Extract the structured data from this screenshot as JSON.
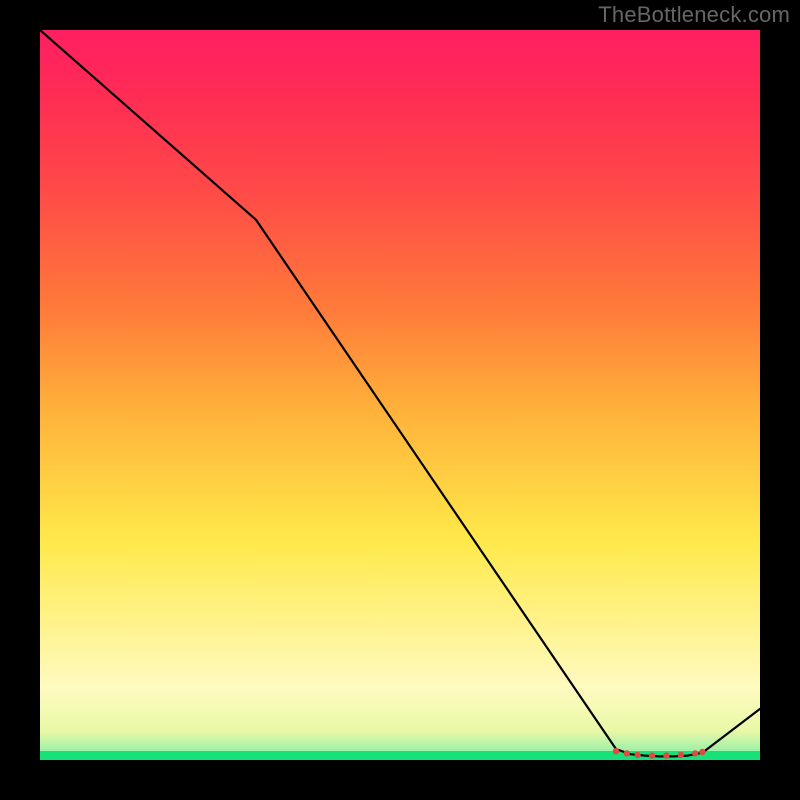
{
  "watermark": "TheBottleneck.com",
  "chart_data": {
    "type": "line",
    "title": "",
    "xlabel": "",
    "ylabel": "",
    "xlim": [
      0,
      100
    ],
    "ylim": [
      0,
      100
    ],
    "series": [
      {
        "name": "bottleneck-curve",
        "x": [
          0,
          30,
          80,
          82,
          84,
          86,
          88,
          90,
          92,
          100
        ],
        "y": [
          100,
          74,
          1.5,
          0.8,
          0.6,
          0.5,
          0.5,
          0.6,
          1.0,
          7
        ]
      }
    ],
    "markers": {
      "name": "flat-region-dots",
      "x": [
        80,
        81.5,
        83,
        85,
        87,
        89,
        91,
        92
      ],
      "y": [
        1.2,
        0.9,
        0.7,
        0.6,
        0.6,
        0.7,
        0.9,
        1.1
      ],
      "color": "#e4483f"
    },
    "gradient_stops": [
      {
        "pos": 0.0,
        "color": "#17e27a"
      },
      {
        "pos": 0.012,
        "color": "#17e27a"
      },
      {
        "pos": 0.04,
        "color": "#e9f9a6"
      },
      {
        "pos": 0.1,
        "color": "#fffac0"
      },
      {
        "pos": 0.3,
        "color": "#ffe94a"
      },
      {
        "pos": 0.48,
        "color": "#ffb13a"
      },
      {
        "pos": 0.62,
        "color": "#ff7a3a"
      },
      {
        "pos": 0.78,
        "color": "#ff4a48"
      },
      {
        "pos": 0.92,
        "color": "#ff2a55"
      },
      {
        "pos": 1.0,
        "color": "#ff1f63"
      }
    ]
  }
}
